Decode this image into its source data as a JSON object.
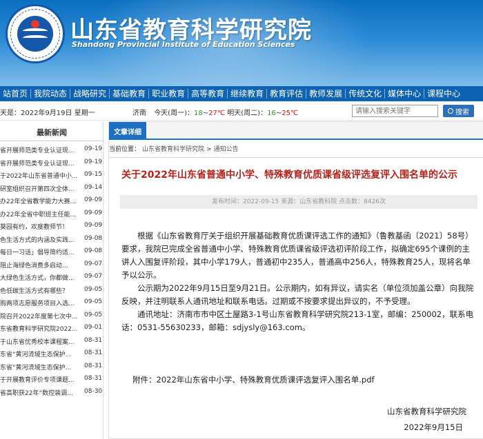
{
  "header": {
    "title": "山东省教育科学研究院",
    "subtitle": "Shandong Provincial Institute of Education Sciences",
    "logo_icon": "institute-seal-logo"
  },
  "nav": {
    "items": [
      "站首页",
      "我院动态",
      "战略研究",
      "基础教育",
      "职业教育",
      "高等教育",
      "继续教育",
      "教育评估",
      "教师发展",
      "传统文化",
      "媒体中心",
      "课程中心"
    ]
  },
  "infobar": {
    "date": "天是：2022年9月19日 星期一",
    "weather_city": "济南",
    "today_label": "今天(周一)：",
    "today_lo": "18",
    "today_hi": "27℃",
    "tomorrow_label": "明天(周二)：",
    "tomorrow_lo": "16",
    "tomorrow_hi": "25℃",
    "search_placeholder": "请输入搜索关键字",
    "search_button": "搜索"
  },
  "sidebar": {
    "title": "最新新闻",
    "items": [
      {
        "title": "省开展师范类专业认证现...",
        "date": "09-19"
      },
      {
        "title": "省开展师范类专业认证现...",
        "date": "09-19"
      },
      {
        "title": "于2022年山东省普通中小...",
        "date": "09-15"
      },
      {
        "title": "研室组织召开第四次全体...",
        "date": "09-14"
      },
      {
        "title": "办22年全省教学能力大赛...",
        "date": "09-09"
      },
      {
        "title": "办22年全省中职班主任能...",
        "date": "09-09"
      },
      {
        "title": "葵园有约，欢度教师节！",
        "date": "09-09"
      },
      {
        "title": "色生活方式的内涵及实践...",
        "date": "09-08"
      },
      {
        "title": "每日一习话」倡导简约适...",
        "date": "09-08"
      },
      {
        "title": "阻止海绿色消费多启动...",
        "date": "09-07"
      },
      {
        "title": "大绿色生活方式，你都做...",
        "date": "09-07"
      },
      {
        "title": "色低碳生活方式有哪些？",
        "date": "09-05"
      },
      {
        "title": "购两项志愿服务项目入选...",
        "date": "09-05"
      },
      {
        "title": "院召开2022年度第七次中...",
        "date": "09-05"
      },
      {
        "title": "东省教育科学研究院2022...",
        "date": "09-01"
      },
      {
        "title": "于山东省优秀校本课程案...",
        "date": "08-31"
      },
      {
        "title": "东省“黄河流域生态保护...",
        "date": "08-31"
      },
      {
        "title": "东省“黄河流域生态保护...",
        "date": "08-31"
      },
      {
        "title": "于开展教育评价专项课题...",
        "date": "08-31"
      },
      {
        "title": "省高职获22年“数控装调...",
        "date": "08-30"
      }
    ]
  },
  "main": {
    "tab_label": "文章详细",
    "breadcrumb_prefix": "当前位置：",
    "breadcrumb_home": "山东省教育科学研究院",
    "breadcrumb_sep": ">",
    "breadcrumb_section": "通知公告",
    "article_title": "关于2022年山东省普通中小学、特殊教育优质课省级评选复评入围名单的公示",
    "meta": "发布时间：2022-09-15  来源：山东省教科院  点击数：8426次",
    "paragraphs": [
      "根据《山东省教育厅关于组织开展基础教育优质课评选工作的通知》（鲁教基函〔2021〕58号）要求，我院已完成全省普通中小学、特殊教育优质课省级评选初评阶段工作，拟确定695个课例的主讲人入围复评阶段，其中小学179人，普通初中235人，普通高中256人，特殊教育25人，现将名单予以公示。",
      "公示期为2022年9月15日至9月21日。公示期内，如有异议，请实名（单位须加盖公章）向我院反映，并注明联系人通讯地址和联系电话。过期或不按要求提出异议的，不予受理。",
      "通讯地址：济南市市中区土屋路3-1号山东省教育科学研究院213-1室，邮编：250002，联系电话：0531-55630233，邮箱：sdjysly@163.com。"
    ],
    "attachment": "附件：2022年山东省中小学、特殊教育优质课评选复评入围名单.pdf",
    "signature_org": "山东省教育科学研究院",
    "signature_date": "2022年9月15日"
  }
}
